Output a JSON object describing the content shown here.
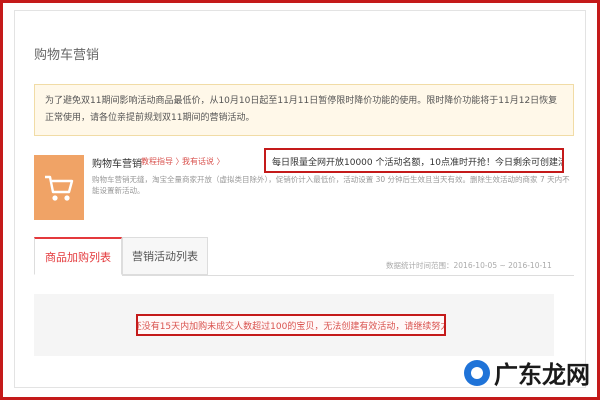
{
  "page": {
    "title": "购物车营销"
  },
  "notice": {
    "text": "为了避免双11期间影响活动商品最低价，从10月10日起至11月11日暂停限时降价功能的使用。限时降价功能将于11月12日恢复正常使用，请各位亲提前规划双11期间的营销活动。"
  },
  "tool": {
    "icon": "shopping-cart-icon",
    "name": "购物车营销",
    "link_guide": "教程指导 〉",
    "link_feedback": "我有话说 〉",
    "description": "购物车营销无缝，淘宝全量商家开放（虚拟类目除外），促销价计入最低价，活动设置 30 分钟后生效且当天有效。删除生效活动的商家 7 天内不能设置新活动。",
    "quota": "每日限量全网开放10000 个活动名额，10点准时开抢！今日剩余可创建活动数：0"
  },
  "tabs": [
    {
      "label": "商品加购列表",
      "active": true
    },
    {
      "label": "营销活动列表",
      "active": false
    }
  ],
  "stats": {
    "text": "数据统计时间范围：2016-10-05 ~ 2016-10-11"
  },
  "empty": {
    "message": "您还没有15天内加购未成交人数超过100的宝贝，无法创建有效活动，请继续努力！"
  },
  "watermark": {
    "text": "广东龙网"
  },
  "colors": {
    "accent_red": "#c41a1a",
    "tab_red": "#e4393c",
    "icon_orange": "#f0a366",
    "notice_bg": "#fff8e9"
  }
}
